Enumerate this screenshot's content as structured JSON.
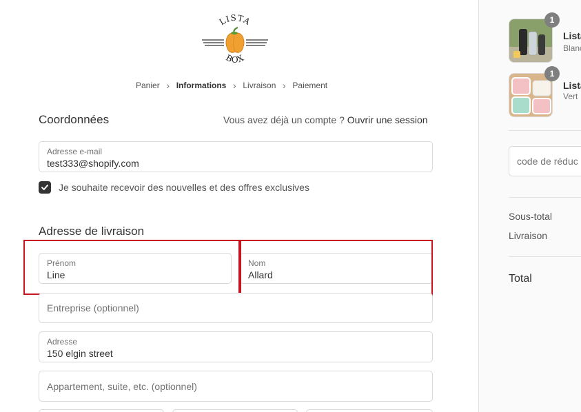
{
  "logo": {
    "top_text": "LISTA",
    "bottom_text": "BOX",
    "icon": "pepper-icon"
  },
  "breadcrumb": {
    "items": [
      "Panier",
      "Informations",
      "Livraison",
      "Paiement"
    ],
    "active_index": 1,
    "separator_icon": "chevron-right-icon"
  },
  "contact": {
    "title": "Coordonnées",
    "login_prompt": "Vous avez déjà un compte ?",
    "login_link": "Ouvrir une session",
    "email": {
      "label": "Adresse e-mail",
      "value": "test333@shopify.com"
    },
    "newsletter": {
      "label": "Je souhaite recevoir des nouvelles et des offres exclusives",
      "checked": true
    }
  },
  "shipping": {
    "title": "Adresse de livraison",
    "first_name": {
      "label": "Prénom",
      "value": "Line"
    },
    "last_name": {
      "label": "Nom",
      "value": "Allard"
    },
    "company": {
      "placeholder": "Entreprise (optionnel)"
    },
    "address": {
      "label": "Adresse",
      "value": "150 elgin street"
    },
    "apartment": {
      "placeholder": "Appartement, suite, etc. (optionnel)"
    }
  },
  "sidebar": {
    "products": [
      {
        "name": "Lista",
        "variant": "Blanc",
        "quantity": "1"
      },
      {
        "name": "Lista",
        "variant": "Vert",
        "quantity": "1"
      }
    ],
    "discount": {
      "placeholder": "code de réduc"
    },
    "subtotal_label": "Sous-total",
    "shipping_label": "Livraison",
    "total_label": "Total"
  },
  "colors": {
    "accent": "#333333",
    "highlight": "#c4161c",
    "pepper": "#f0a030"
  }
}
